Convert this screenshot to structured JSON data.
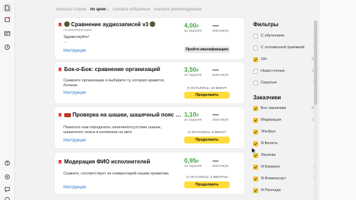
{
  "sidebar": {
    "icons": [
      "document-icon",
      "inbox-icon",
      "message-icon",
      "history-icon",
      "help-icon",
      "settings-icon",
      "chat-icon",
      "info-icon"
    ]
  },
  "sort": {
    "items": [
      "сначала старые",
      "по цене ↓",
      "сначала избранные",
      "сначала рекомендуемые"
    ],
    "active_index": 1
  },
  "tasks": [
    {
      "title": "Сравнение аудиозаписей v3",
      "emoji": "soldier",
      "subtitle": "на квалификации",
      "description_lines": [
        "Здравствуйте!",
        "..."
      ],
      "link": "Инструкция",
      "price": "4,00",
      "currency": "₽",
      "price_label": "за задание",
      "max_value": "—",
      "max_label": "максимум",
      "remaining": "",
      "button": "Пройти квалификацию",
      "button_style": "grey"
    },
    {
      "title": "Бок-о-Бок: сравнение организаций",
      "emoji": "",
      "subtitle": "",
      "description_lines": [
        "Сравните организации и выберите ту, которая нравится",
        "больше."
      ],
      "link": "Инструкция",
      "price": "3,50",
      "currency": "₽",
      "price_label": "за задание",
      "max_value": "—",
      "max_label": "максимум",
      "remaining": "ОСТАЛОСЬ: 19 МИНУТ",
      "button": "Продолжить",
      "button_style": "yellow"
    },
    {
      "title": "Проверка на шашки, шашечный пояс и к...",
      "emoji": "car",
      "subtitle": "",
      "description_lines": [
        "Помогите нам определить наличие/отсутствие шашек,",
        "шашечного пояса и колпачков на авто"
      ],
      "link": "Инструкция",
      "price": "1,10",
      "currency": "₽",
      "price_label": "за задание",
      "max_value": "—",
      "max_label": "максимум",
      "remaining": "ОСТАЛОСЬ: 6 МИНУТ",
      "button": "Продолжить",
      "button_style": "yellow"
    },
    {
      "title": "Модерация ФИО исполнителей",
      "emoji": "",
      "subtitle": "",
      "description_lines": [
        "Скажите, соответствует ли комментарий нашим правилам.",
        ""
      ],
      "link": "Инструкция",
      "price": "0,95",
      "currency": "₽",
      "price_label": "за задание",
      "max_value": "—",
      "max_label": "максимум",
      "remaining": "ОСТАЛОСЬ: 3 МИНУТЫ",
      "button": "Продолжить",
      "button_style": "yellow"
    }
  ],
  "filters": {
    "title": "Фильтры",
    "items": [
      {
        "label": "С обучением",
        "checked": false,
        "count": "1"
      },
      {
        "label": "С отложенной приёмкой",
        "checked": false,
        "count": "9"
      },
      {
        "label": "18+",
        "checked": true,
        "count": "83"
      },
      {
        "label": "Недоступные",
        "checked": false,
        "count": "13"
      },
      {
        "label": "Скрытые",
        "checked": false,
        "count": "8"
      }
    ]
  },
  "requesters": {
    "title": "Заказчики",
    "items": [
      {
        "label": "Все заказчики",
        "checked": true,
        "count": "88"
      },
      {
        "label": "Модерация",
        "checked": true,
        "count": "11"
      },
      {
        "label": "Эльбрус",
        "checked": true,
        "count": "9"
      },
      {
        "label": "Я.Велета",
        "checked": true,
        "count": "7"
      },
      {
        "label": "Лисичка",
        "checked": true,
        "count": "6"
      },
      {
        "label": "Я.Камерун",
        "checked": true,
        "count": "6"
      },
      {
        "label": "Я.Фомальгаут",
        "checked": true,
        "count": "5"
      },
      {
        "label": "Я.Паллада",
        "checked": true,
        "count": "4"
      }
    ]
  },
  "colors": {
    "accent": "#ffdc3c",
    "price": "#42a840",
    "link": "#1e6fd9",
    "bookmark": "#e53935"
  }
}
